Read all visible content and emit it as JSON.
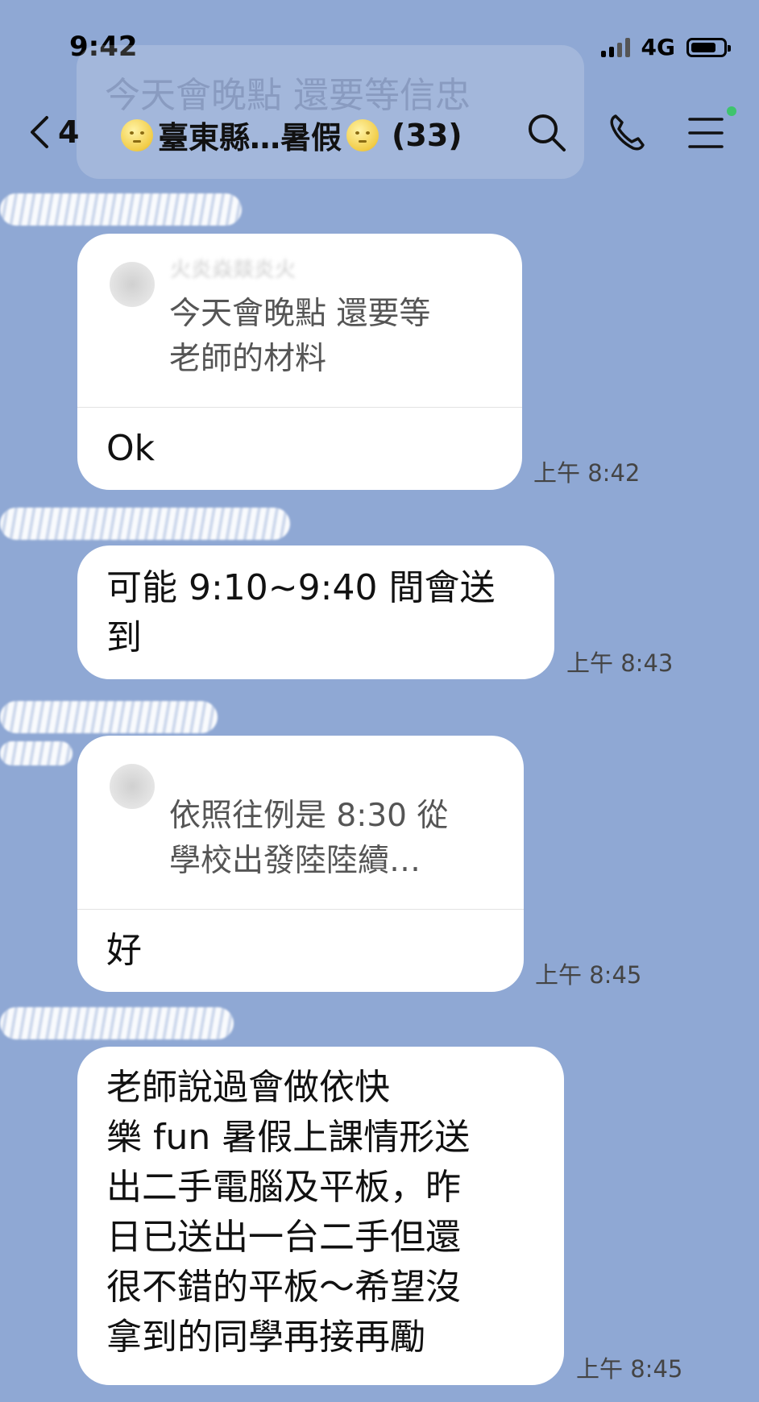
{
  "status_bar": {
    "time": "9:42",
    "network": "4G"
  },
  "header": {
    "back_count": "4",
    "title": "臺東縣…暑假",
    "member_count": "(33)"
  },
  "faded_banner": {
    "text": "今天會晚點 還要等信忠"
  },
  "messages": [
    {
      "reply_name": "火炎焱燚炎火",
      "reply_text": "今天會晚點 還要等\n老師的材料",
      "text": "Ok",
      "time": "上午 8:42"
    },
    {
      "text": "可能 9:10~9:40 間會送\n到",
      "time": "上午 8:43"
    },
    {
      "reply_name": "",
      "reply_text": "依照往例是 8:30 從\n學校出發陸陸續…",
      "text": "好",
      "time": "上午 8:45"
    },
    {
      "text": "老師說過會做依快\n樂 fun 暑假上課情形送\n出二手電腦及平板，昨\n日已送出一台二手但還\n很不錯的平板～希望沒\n拿到的同學再接再勵",
      "time": "上午 8:45"
    }
  ],
  "icons": [
    "back-chevron-icon",
    "search-icon",
    "phone-icon",
    "menu-icon",
    "moon-emoji-icon"
  ],
  "colors": {
    "background": "#8fa8d4",
    "bubble": "#ffffff",
    "online_dot": "#3ec46d"
  }
}
